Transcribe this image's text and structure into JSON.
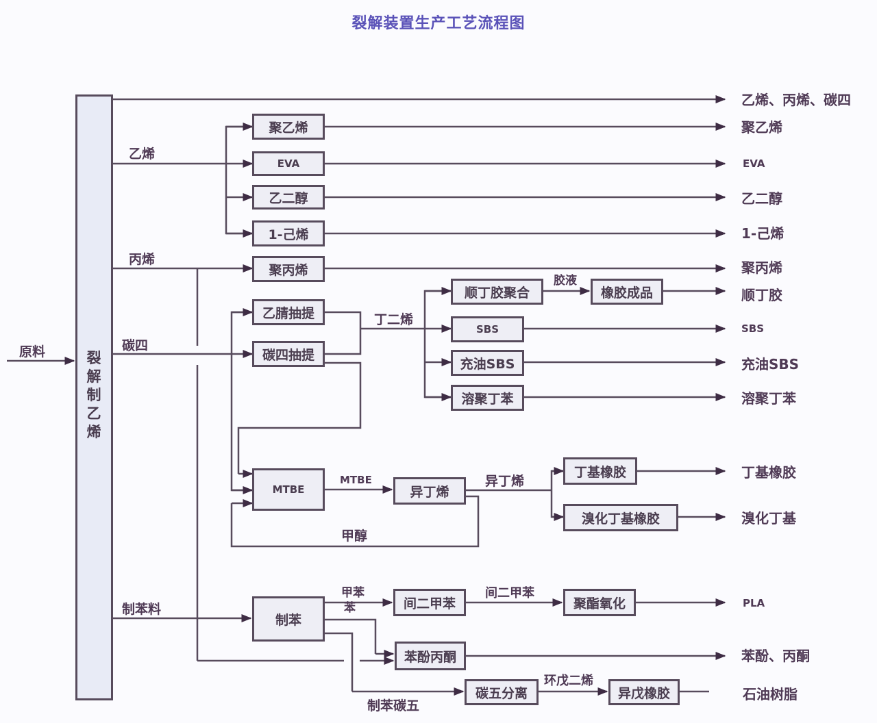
{
  "title": "裂解装置生产工艺流程图",
  "feed": {
    "label": "原料"
  },
  "main_unit": {
    "label": "裂解制乙烯"
  },
  "streams": {
    "ethylene": "乙烯",
    "propylene": "丙烯",
    "c4": "碳四",
    "benzene_feed": "制苯料",
    "butadiene": "丁二烯",
    "glue": "胶液",
    "mtbe": "MTBE",
    "isobutylene": "异丁烯",
    "methanol": "甲醇",
    "toluene": "甲苯",
    "benzene": "苯",
    "m_xylene": "间二甲苯",
    "cyclopentadiene": "环戊二烯",
    "c5_from_benzene": "制苯碳五"
  },
  "units": {
    "pe": "聚乙烯",
    "eva": "EVA",
    "eg": "乙二醇",
    "hexene": "1-己烯",
    "pp": "聚丙烯",
    "acn_extraction": "乙腈抽提",
    "c4_extraction": "碳四抽提",
    "br_polymerization": "顺丁胶聚合",
    "rubber_product": "橡胶成品",
    "sbs": "SBS",
    "oe_sbs": "充油SBS",
    "ssbr": "溶聚丁苯",
    "mtbe": "MTBE",
    "isobutylene": "异丁烯",
    "iir": "丁基橡胶",
    "biir": "溴化丁基橡胶",
    "benzene": "制苯",
    "m_xylene": "间二甲苯",
    "oxidation": "聚酯氧化",
    "phenol_acetone": "苯酚丙酮",
    "c5_separation": "碳五分离",
    "isoprene_rubber": "异戊橡胶"
  },
  "outputs": {
    "light_olefins": "乙烯、丙烯、碳四",
    "pe": "聚乙烯",
    "eva": "EVA",
    "eg": "乙二醇",
    "hexene": "1-己烯",
    "pp": "聚丙烯",
    "br": "顺丁胶",
    "sbs": "SBS",
    "oe_sbs": "充油SBS",
    "ssbr": "溶聚丁苯",
    "iir": "丁基橡胶",
    "biir": "溴化丁基",
    "pla": "PLA",
    "phenol_acetone": "苯酚、丙酮",
    "petroleum_resin": "石油树脂"
  },
  "colors": {
    "line": "#574b5c",
    "box_fill": "#eeeef5",
    "title": "#5a52b8"
  }
}
